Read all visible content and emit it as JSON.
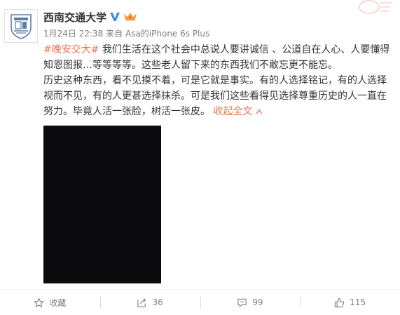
{
  "user": {
    "name": "西南交通大学",
    "verified_icon": "verified-v-icon",
    "member_icon": "crown-member-icon",
    "avatar_icon": "university-logo-icon"
  },
  "post": {
    "time": "1月24日 22:38",
    "source_prefix": "来自",
    "source": "Asa的iPhone 6s Plus",
    "hashtag": "#晚安交大#",
    "line1": " 我们生活在这个社会中总说人要讲诚信 、公道自在人心、人要懂得知恩图报…等等等等。这些老人留下来的东西我们不敢忘更不能忘。",
    "line2": "历史这种东西，看不见摸不着，可是它就是事实。有的人选择铭记，有的人选择视而不见，有的人更甚选择抹杀。可是我们这些看得见选择尊重历史的人一直在努力。毕竟人活一张脸，树活一张皮。",
    "collapse_label": "收起全文",
    "collapse_icon": "chevron-up-icon"
  },
  "actions": {
    "favorite_label": "收藏",
    "repost_count": "36",
    "comment_count": "99",
    "like_count": "115"
  },
  "colors": {
    "accent": "#eb7350",
    "text": "#333333",
    "muted": "#808080"
  }
}
